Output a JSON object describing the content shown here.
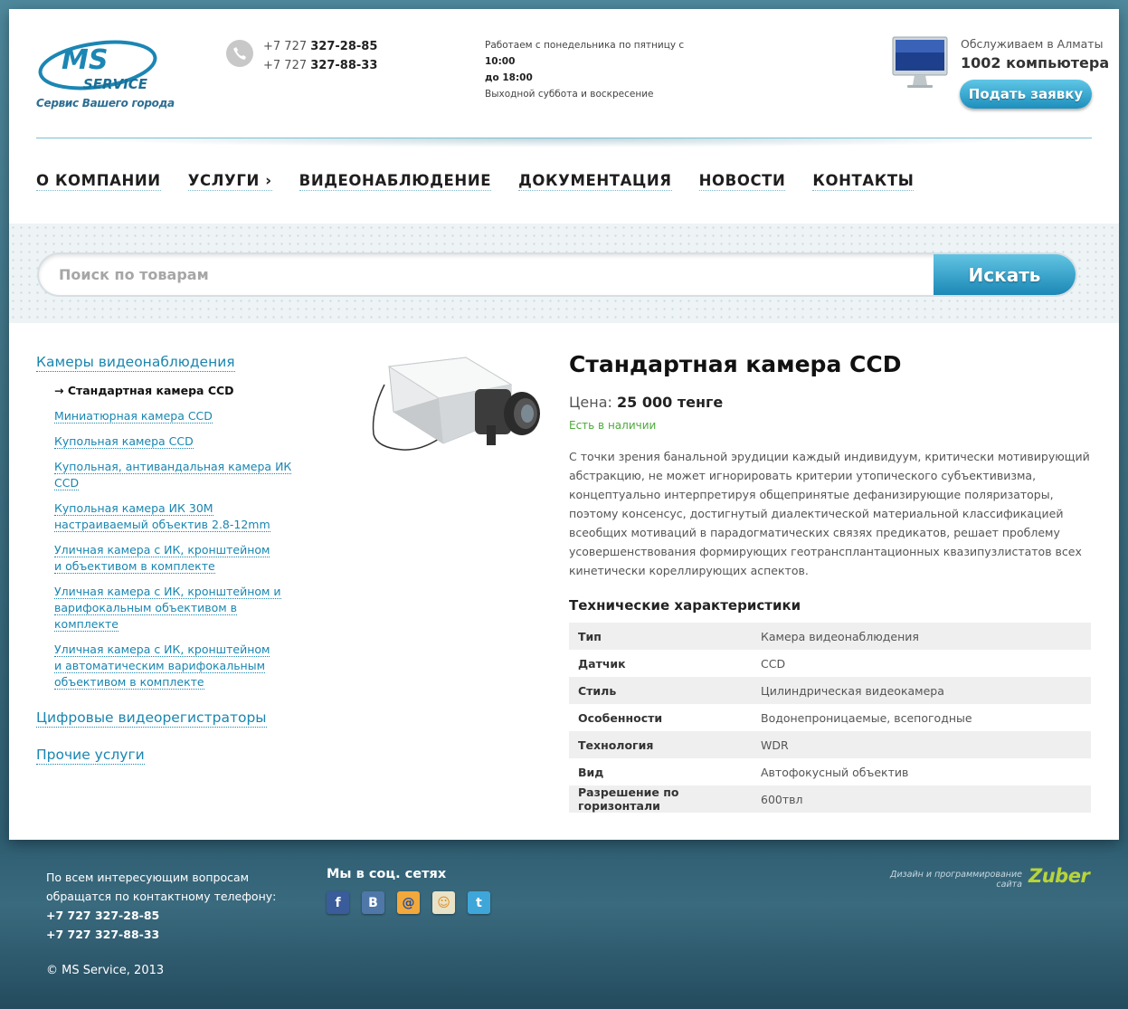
{
  "header": {
    "logo_line1": "MS",
    "logo_line2": "SERVICE",
    "tagline": "Сервис Вашего города",
    "phones": [
      {
        "prefix": "+7 727 ",
        "number": "327-28-85"
      },
      {
        "prefix": "+7 727 ",
        "number": "327-88-33"
      }
    ],
    "hours_line1_a": "Работаем с понедельника по пятницу с ",
    "hours_line1_b": "10:00",
    "hours_line2": "до 18:00",
    "hours_line3": "Выходной суббота и воскресение",
    "serve_label": "Обслуживаем в Алматы",
    "serve_count": "1002 компьютера",
    "request_button": "Подать заявку"
  },
  "nav": [
    "О КОМПАНИИ",
    "УСЛУГИ ›",
    "ВИДЕОНАБЛЮДЕНИЕ",
    "ДОКУМЕНТАЦИЯ",
    "НОВОСТИ",
    "КОНТАКТЫ"
  ],
  "search": {
    "placeholder": "Поиск по товарам",
    "button": "Искать"
  },
  "sidebar": {
    "categories": [
      {
        "label": "Камеры видеонаблюдения",
        "items": [
          {
            "label": "→ Стандартная камера CCD",
            "active": true
          },
          {
            "label": "Миниатюрная камера CCD"
          },
          {
            "label": "Купольная камера CCD"
          },
          {
            "label": "Купольная, антивандальная камера ИК CCD"
          },
          {
            "label": "Купольная камера ИК 30М настраиваемый объектив 2.8-12mm"
          },
          {
            "label": "Уличная камера с ИК, кронштейном и объективом в комплекте"
          },
          {
            "label": "Уличная камера с ИК, кронштейном и варифокальным объективом в комплекте"
          },
          {
            "label": "Уличная камера с ИК, кронштейном и автоматическим варифокальным объективом в комплекте"
          }
        ]
      },
      {
        "label": "Цифровые видеорегистраторы",
        "items": []
      },
      {
        "label": "Прочие услуги",
        "items": []
      }
    ]
  },
  "product": {
    "title": "Стандартная камера CCD",
    "price_label": "Цена: ",
    "price_value": "25 000 тенге",
    "stock": "Есть в наличии",
    "description": "С точки зрения банальной эрудиции каждый индивидуум, критически мотивирующий абстракцию, не может игнорировать критерии утопического субъективизма, концептуально интерпретируя общепринятые дефанизирующие поляризаторы, поэтому консенсус, достигнутый диалектической материальной классификацией всеобщих мотиваций в парадогматических связях предикатов, решает проблему усовершенствования формирующих геотрансплантационных квазипузлистатов всех кинетически кореллирующих аспектов.",
    "spec_title": "Технические характеристики",
    "specs": [
      {
        "key": "Тип",
        "value": "Камера видеонаблюдения"
      },
      {
        "key": "Датчик",
        "value": "CCD"
      },
      {
        "key": "Стиль",
        "value": "Цилиндрическая видеокамера"
      },
      {
        "key": "Особенности",
        "value": "Водонепроницаемые, всепогодные"
      },
      {
        "key": "Технология",
        "value": "WDR"
      },
      {
        "key": "Вид",
        "value": "Автофокусный объектив"
      },
      {
        "key": "Разрешение по горизонтали",
        "value": "600твл"
      }
    ]
  },
  "footer": {
    "contact_line1": "По всем интересующим вопросам",
    "contact_line2": "обращатся по контактному телефону:",
    "phone1": "+7 727 327-28-85",
    "phone2": "+7 727 327-88-33",
    "copyright": "© MS Service, 2013",
    "social_title": "Мы в соц. сетях",
    "social": [
      {
        "icon": "facebook-icon",
        "glyph": "f",
        "color": "#3b5c9a"
      },
      {
        "icon": "vkontakte-icon",
        "glyph": "B",
        "color": "#4f77a8"
      },
      {
        "icon": "mailru-icon",
        "glyph": "@",
        "color": "#1f6ab0"
      },
      {
        "icon": "odnoklassniki-icon",
        "glyph": "☺",
        "color": "#f0a53a"
      },
      {
        "icon": "twitter-icon",
        "glyph": "t",
        "color": "#3fa6d9"
      }
    ],
    "design_credit": "Дизайн и программирование сайта",
    "design_brand": "Zuber"
  }
}
